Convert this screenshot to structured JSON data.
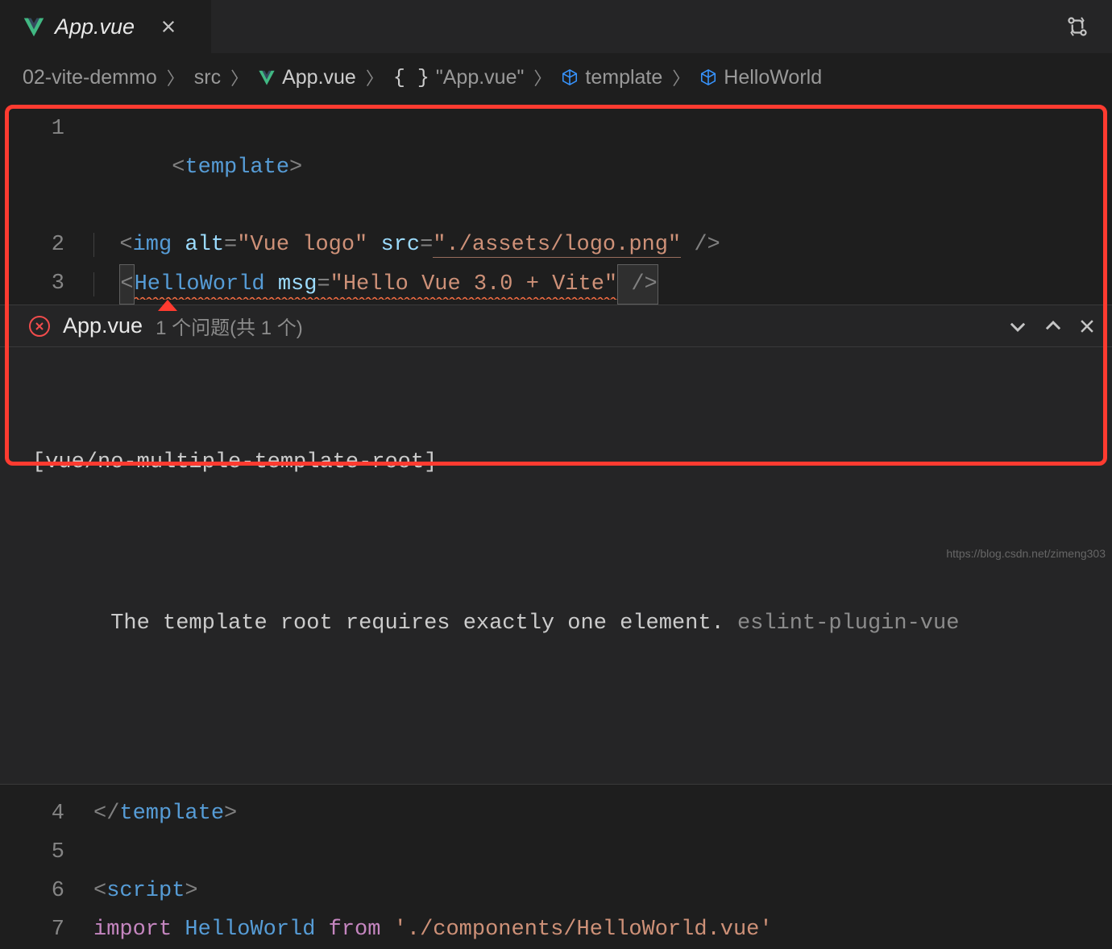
{
  "tab": {
    "title": "App.vue",
    "icon": "vue-icon"
  },
  "actions": {
    "git_compare": "git-compare-icon"
  },
  "breadcrumb": [
    {
      "label": "02-vite-demmo",
      "icon": null
    },
    {
      "label": "src",
      "icon": null
    },
    {
      "label": "App.vue",
      "icon": "vue"
    },
    {
      "label": "\"App.vue\"",
      "icon": "braces"
    },
    {
      "label": "template",
      "icon": "cube"
    },
    {
      "label": "HelloWorld",
      "icon": "cube"
    }
  ],
  "code": {
    "line1": {
      "no": "1",
      "open": "<",
      "tag": "template",
      "close": ">"
    },
    "line2": {
      "no": "2",
      "open": "<",
      "tag": "img",
      "attr1": "alt",
      "val1": "\"Vue logo\"",
      "attr2": "src",
      "val2": "\"./assets/logo.png\"",
      "selfclose": " />"
    },
    "line3": {
      "no": "3",
      "open": "<",
      "tag": "HelloWorld",
      "attr": "msg",
      "val": "\"Hello Vue 3.0 + Vite\"",
      "selfclose": " />"
    },
    "line4": {
      "no": "4",
      "open": "</",
      "tag": "template",
      "close": ">"
    },
    "line5": {
      "no": "5",
      "blank": ""
    },
    "line6": {
      "no": "6",
      "open": "<",
      "tag": "script",
      "close": ">"
    },
    "line7": {
      "no": "7",
      "kw": "import",
      "name": "HelloWorld",
      "from": "from",
      "path": "'./components/HelloWorld.vue'"
    }
  },
  "problems": {
    "file": "App.vue",
    "count_text": "1 个问题(共 1 个)",
    "rule": "[vue/no-multiple-template-root]",
    "message": "The template root requires exactly one element.",
    "source": "eslint-plugin-vue"
  },
  "watermark": "https://blog.csdn.net/zimeng303"
}
